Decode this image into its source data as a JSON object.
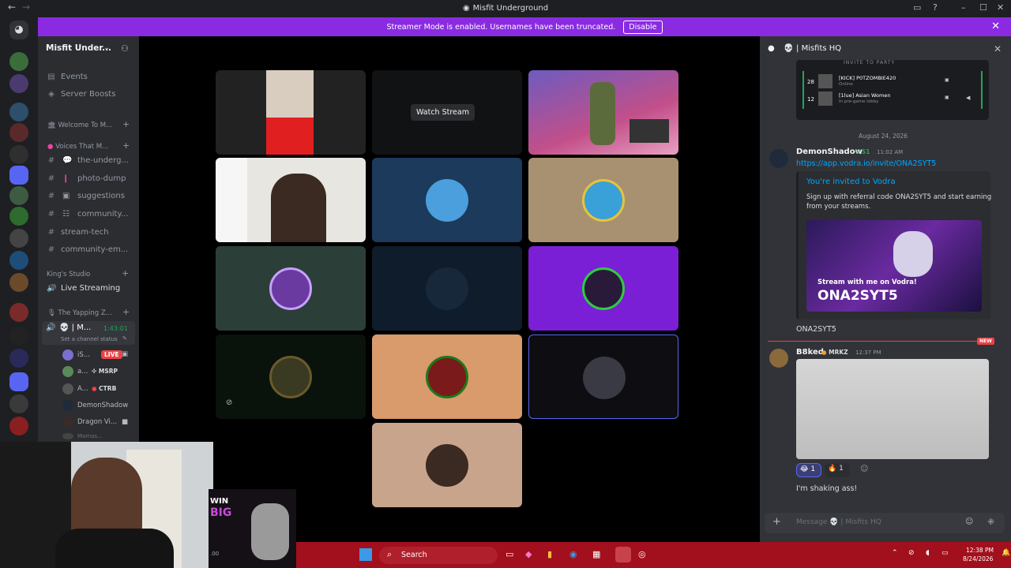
{
  "window": {
    "title": "Misfit Underground",
    "back": "←",
    "forward": "→"
  },
  "banner": {
    "text": "Streamer Mode is enabled. Usernames have been truncated.",
    "button": "Disable"
  },
  "server": {
    "name": "Misfit Under..."
  },
  "channels": {
    "events": "Events",
    "boosts": "Server Boosts",
    "cat_welcome": "Welcome To M...",
    "cat_voices": "Voices That M...",
    "items": [
      {
        "icon": "#",
        "label": "the-underg..."
      },
      {
        "icon": "#",
        "label": "photo-dump"
      },
      {
        "icon": "#",
        "label": "suggestions"
      },
      {
        "icon": "#",
        "label": "community..."
      },
      {
        "icon": "#",
        "label": "stream-tech"
      },
      {
        "icon": "#",
        "label": "community-em..."
      }
    ],
    "cat_kings": "King's Studio",
    "live_streaming": "Live Streaming",
    "cat_yapping": "The Yapping Z...",
    "voice_channel": {
      "name": "M...",
      "timer": "1:43:01",
      "status": "Set a channel status"
    },
    "voice_users": [
      {
        "name": "iS...",
        "tag": "LIVE"
      },
      {
        "name": "a...",
        "tag": "MSRP"
      },
      {
        "name": "A...",
        "tag": "CTRB"
      },
      {
        "name": "DemonShadow",
        "tag": ""
      },
      {
        "name": "Dragon Vi...",
        "tag": ""
      },
      {
        "name": "Mamas...",
        "tag": ""
      }
    ]
  },
  "stage": {
    "watch_stream": "Watch Stream"
  },
  "panel": {
    "title": "Misfits HQ",
    "invite_header": "INVITE TO PARTY",
    "party": [
      {
        "level": "28",
        "name": "[KICK] P0TZOMBIE420",
        "status": "Online"
      },
      {
        "level": "12",
        "name": "[1lue] Asian Women",
        "status": "In pre-game lobby"
      }
    ],
    "date": "August 24, 2026",
    "msg1": {
      "author": "DemonShadow",
      "badge": "S1",
      "time": "11:02 AM",
      "link": "https://app.vodra.io/invite/ONA2SYT5",
      "embed_title": "You're invited to Vodra",
      "embed_desc1": "Sign up with referral code ONA2SYT5 and start earning",
      "embed_desc2": "from your streams.",
      "embed_img_line1": "Stream with me on Vodra!",
      "embed_img_line2": "ONA2SYT5",
      "after": "ONA2SYT5"
    },
    "new_label": "NEW",
    "msg2": {
      "author": "B8ked",
      "badge": "MRKZ",
      "time": "12:37 PM",
      "react1_count": "1",
      "react2_count": "1",
      "text": "I'm shaking ass!"
    },
    "composer": {
      "placeholder": "Message 💀 | Misfits HQ"
    }
  },
  "ad": {
    "line1": "WIN",
    "line2": "BIG",
    "small": ".00"
  },
  "taskbar": {
    "search": "Search",
    "time": "12:38 PM",
    "date": "8/24/2026"
  },
  "colors": {
    "accent": "#8a2be2",
    "link": "#00a8fc",
    "live": "#ed4245",
    "taskbar": "#a1101c"
  }
}
